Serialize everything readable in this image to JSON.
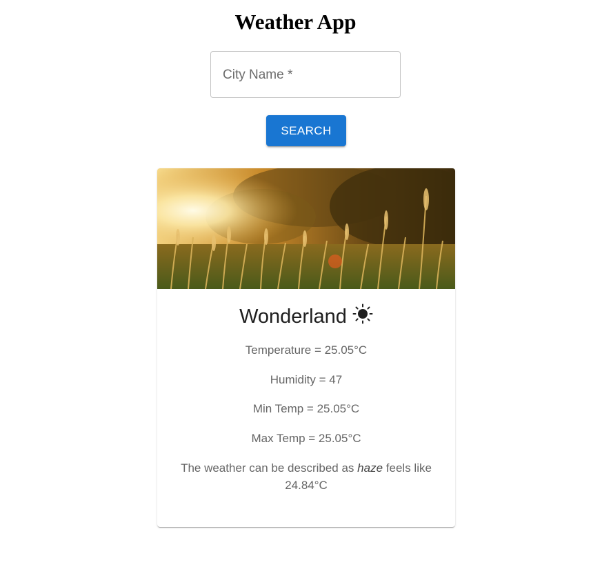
{
  "app": {
    "title": "Weather App"
  },
  "search": {
    "label": "City Name *",
    "value": "",
    "button_label": "SEARCH"
  },
  "card": {
    "image_icon": "wheat-field-sunset-image",
    "city": "Wonderland",
    "weather_icon": "sun-icon",
    "temperature": "Temperature = 25.05°C",
    "humidity": "Humidity = 47",
    "min_temp": "Min Temp = 25.05°C",
    "max_temp": "Max Temp = 25.05°C",
    "description_prefix": "The weather can be described as",
    "description_condition": "haze",
    "description_suffix": "feels like 24.84°C"
  },
  "colors": {
    "accent": "#1976d2",
    "card_text": "#666666"
  }
}
